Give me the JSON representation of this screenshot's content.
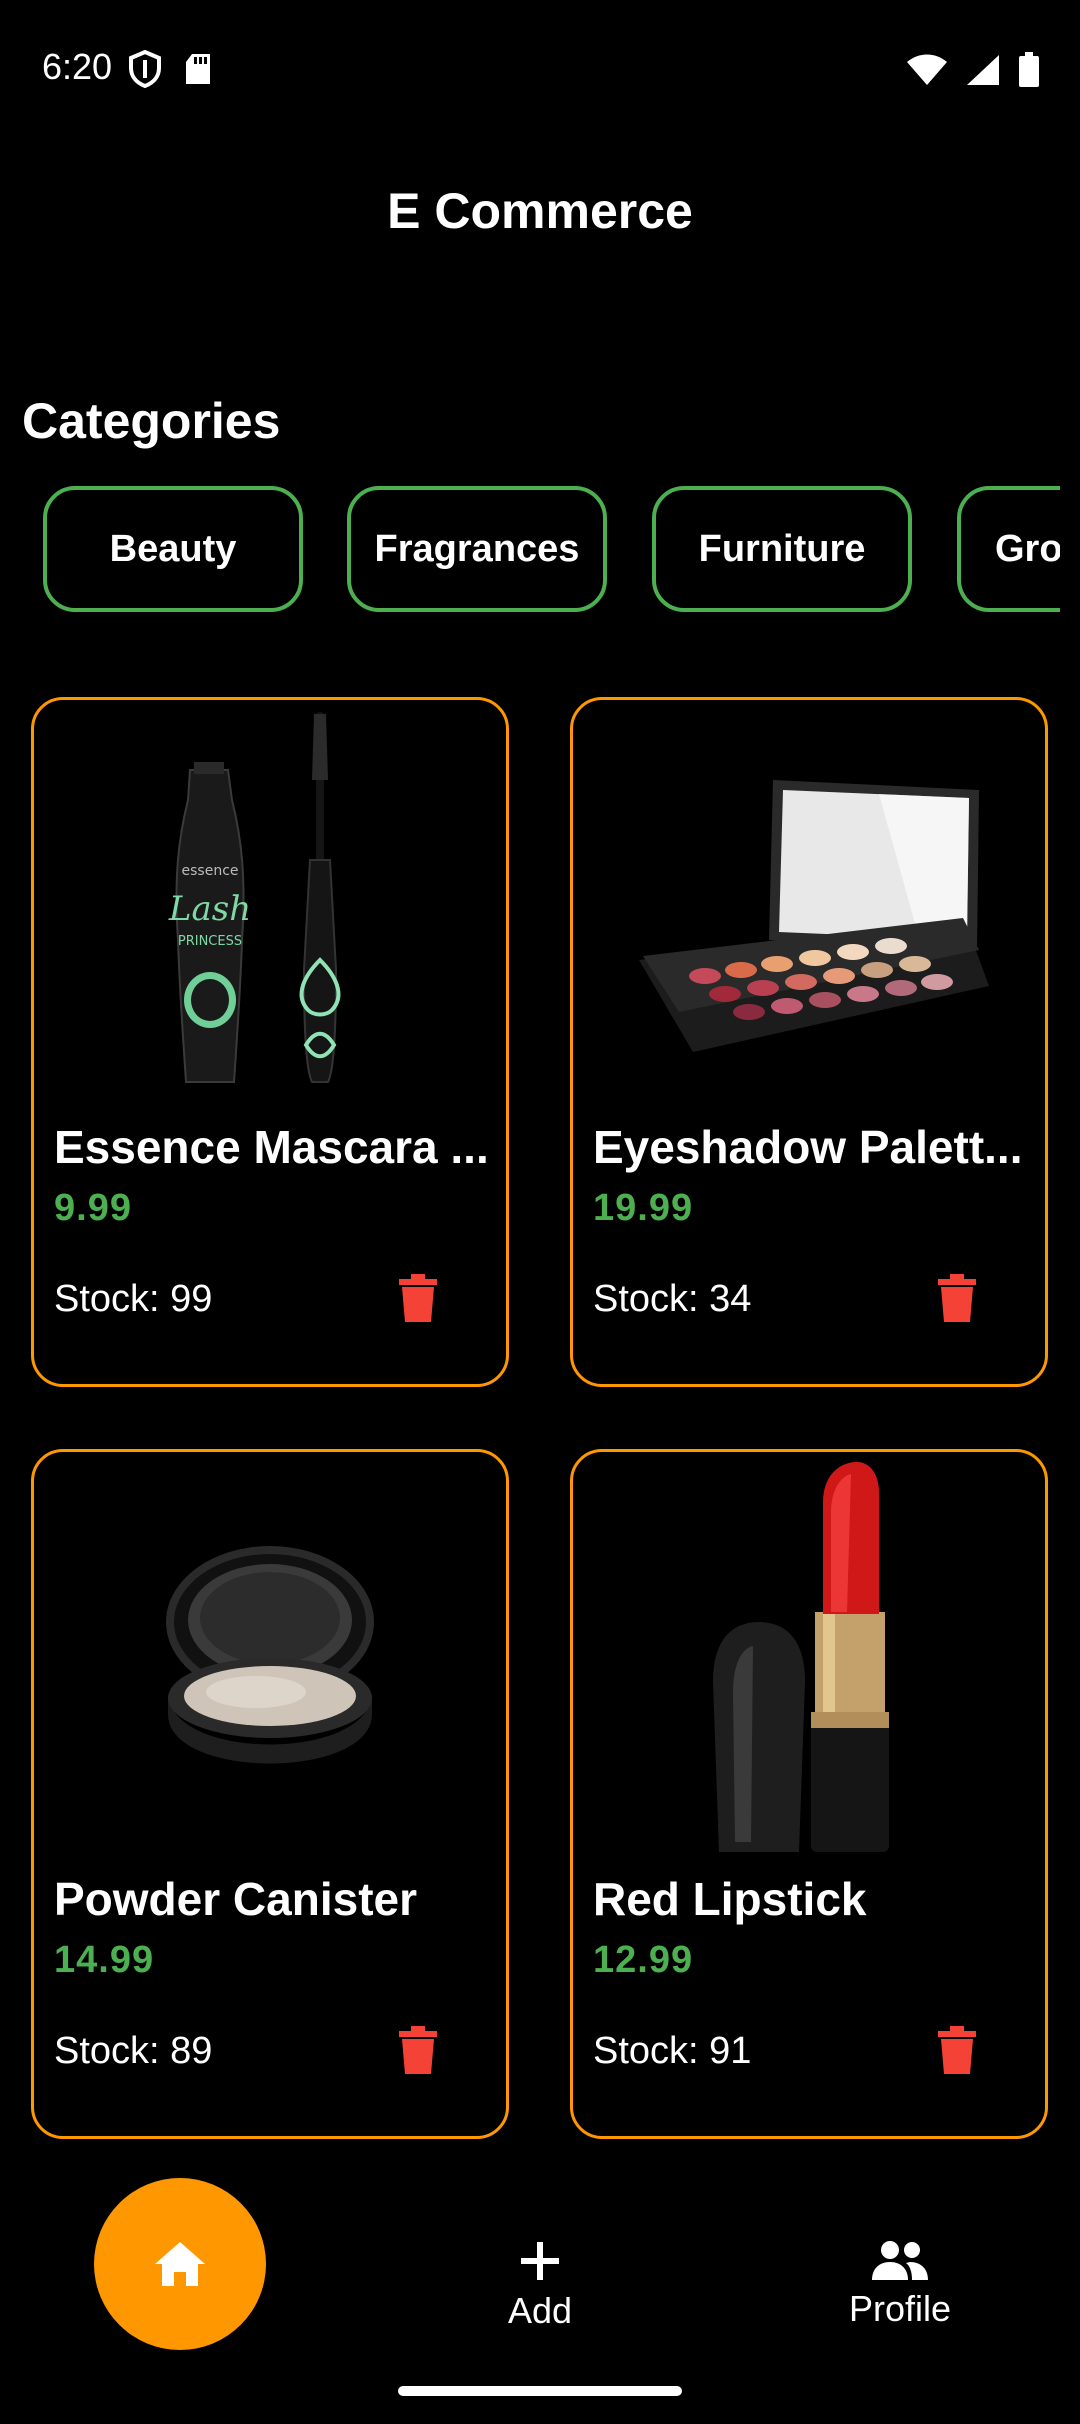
{
  "status_bar": {
    "time": "6:20"
  },
  "app": {
    "title": "E Commerce"
  },
  "categories": {
    "title": "Categories",
    "items": [
      "Beauty",
      "Fragrances",
      "Furniture",
      "Gro"
    ]
  },
  "products": [
    {
      "name": "Essence Mascara ...",
      "price": "9.99",
      "stock": "Stock: 99"
    },
    {
      "name": "Eyeshadow Palett...",
      "price": "19.99",
      "stock": "Stock: 34"
    },
    {
      "name": "Powder Canister",
      "price": "14.99",
      "stock": "Stock: 89"
    },
    {
      "name": "Red Lipstick",
      "price": "12.99",
      "stock": "Stock: 91"
    }
  ],
  "bottom_nav": {
    "add_label": "Add",
    "profile_label": "Profile"
  },
  "colors": {
    "accent": "#ff9800",
    "chip_border": "#4caf50",
    "price": "#4caf50",
    "delete": "#f44336"
  }
}
